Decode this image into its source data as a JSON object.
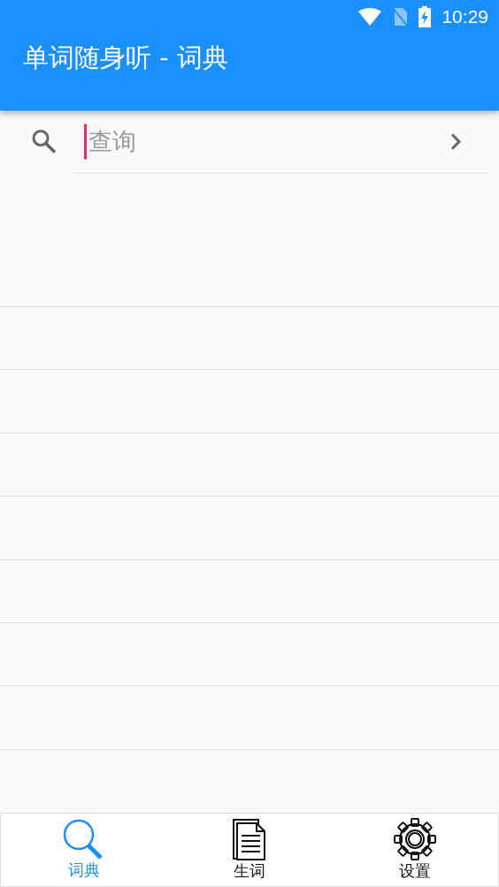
{
  "status_bar": {
    "time": "10:29"
  },
  "app_bar": {
    "title": "单词随身听 - 词典"
  },
  "search": {
    "placeholder": "查询"
  },
  "tabs": [
    {
      "label": "词典",
      "kind": "search",
      "selected": true
    },
    {
      "label": "生词",
      "kind": "document",
      "selected": false
    },
    {
      "label": "设置",
      "kind": "gear",
      "selected": false
    }
  ]
}
